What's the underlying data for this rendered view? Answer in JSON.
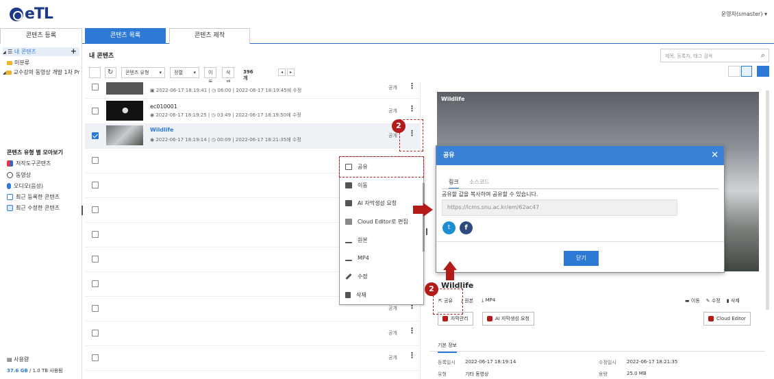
{
  "header": {
    "logo": "eTL",
    "user": "운영자(smaster)"
  },
  "tabs": [
    "콘텐츠 등록",
    "콘텐츠 목록",
    "콘텐츠 제작"
  ],
  "sidebar": {
    "tree": [
      {
        "label": "내 콘텐츠"
      },
      {
        "label": "미분류"
      },
      {
        "label": "교수강의 동영상 개발 1차 Pr"
      }
    ],
    "category_title": "콘텐츠 유형 별 모아보기",
    "categories": [
      {
        "label": "저작도구콘텐츠"
      },
      {
        "label": "동영상"
      },
      {
        "label": "오디오(음성)"
      },
      {
        "label": "최근 등록한 콘텐츠"
      },
      {
        "label": "최근 수정한 콘텐츠"
      }
    ],
    "usage_label": "사용량",
    "usage_value_used": "37.6 GB",
    "usage_value_rest": "/ 1.0 TB 사용됨"
  },
  "main": {
    "title": "내 콘텐츠",
    "search_placeholder": "제목, 등록자, 태그 검색",
    "toolbar": {
      "type_label": "콘텐츠 유형",
      "sort_label": "정렬",
      "move": "이동",
      "delete": "삭제",
      "count": "396 개 중 1 - 50"
    }
  },
  "rows": [
    {
      "title": "",
      "created": "2022-06-17 18:19:41",
      "duration": "06:00",
      "modified": "2022-06-17 18:19:45에 수정",
      "public": "공개"
    },
    {
      "title": "ec010001",
      "created": "2022-06-17 18:19:25",
      "duration": "03:49",
      "modified": "2022-06-17 18:19:50에 수정",
      "public": "공개"
    },
    {
      "title": "Wildlife",
      "created": "2022-06-17 18:19:14",
      "duration": "00:09",
      "modified": "2022-06-17 18:21:35에 수정",
      "public": "공개"
    }
  ],
  "row_public_labels": [
    "공개",
    "공개",
    "공개",
    "공개",
    "공개",
    "공개",
    "공개",
    "공개",
    "공개"
  ],
  "context_menu": [
    {
      "label": "공유"
    },
    {
      "label": "이동"
    },
    {
      "label": "AI 자막생성 요청"
    },
    {
      "label": "Cloud Editor로 편집"
    },
    {
      "label": "원본"
    },
    {
      "label": "MP4"
    },
    {
      "label": "수정"
    },
    {
      "label": "삭제"
    }
  ],
  "detail": {
    "video_title": "Wildlife",
    "title": "Wildlife",
    "actions": {
      "share": "공유",
      "original": "원본",
      "mp4": "MP4",
      "move": "이동",
      "edit": "수정",
      "delete": "삭제"
    },
    "buttons": {
      "subtitle": "자막관리",
      "ai_subtitle": "AI 자막생성 요청",
      "cloud_editor": "Cloud Editor"
    },
    "info_tab": "기본 정보",
    "info": {
      "created_label": "등록일시",
      "created": "2022-06-17 18:19:14",
      "modified_label": "수정일시",
      "modified": "2022-06-17 18:21:35",
      "type_label": "유형",
      "type": "기타 동영상",
      "size_label": "용량",
      "size": "25.0 MB"
    }
  },
  "share_modal": {
    "title": "공유",
    "tab_link": "링크",
    "tab_source": "소스코드",
    "desc": "공유할 값을 복사하여 공유할 수 있습니다.",
    "url": "https://lcms.snu.ac.kr/em/62ac47",
    "close": "닫기"
  },
  "annotations": {
    "step": "2"
  },
  "colors": {
    "accent": "#2d7ad6",
    "annotation": "#b31b1b"
  }
}
